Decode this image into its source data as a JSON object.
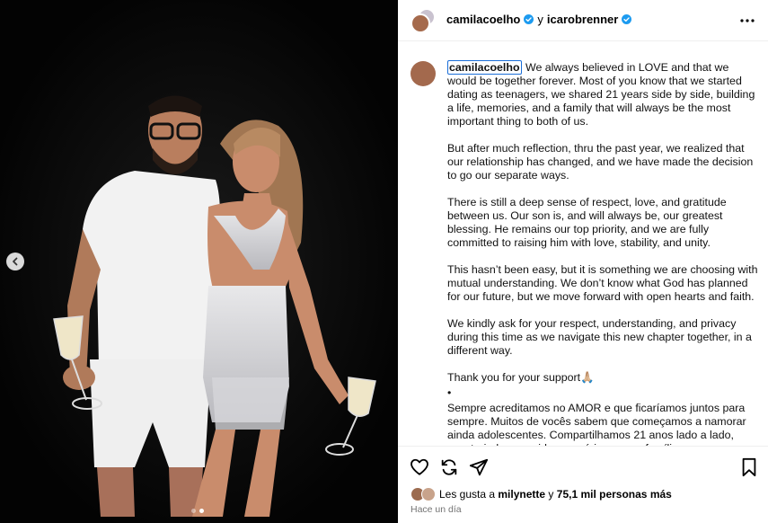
{
  "post": {
    "author": "camilacoelho",
    "joiner": "y",
    "coauthor": "icarobrenner",
    "caption_user": "camilacoelho",
    "caption": [
      "We always believed in LOVE and that we would be together forever. Most of you know that we started dating as teenagers, we shared 21 years side by side, building a life, memories, and a family that will always be the most important thing to both of us.",
      "But after much reflection, thru the past year, we realized that our relationship has changed, and we have made the decision to go our separate ways.",
      "There is still a deep sense of respect, love, and gratitude between us. Our son is, and will always be, our greatest blessing. He remains our top priority, and we are fully committed to raising him with love, stability, and unity.",
      "This hasn’t been easy, but it is something we are choosing with mutual understanding. We don’t know what God has planned for our future, but we move forward with open hearts and faith.",
      "We kindly ask for your respect, understanding, and privacy during this time as we navigate this new chapter together, in a different way.",
      "Thank you for your support🙏🏼",
      "•",
      "Sempre acreditamos no AMOR e que ficaríamos juntos para sempre. Muitos de vocês sabem que começamos a namorar ainda adolescentes. Compartilhamos 21 anos lado a lado, construindo uma vida, memórias e uma família que sempre será"
    ],
    "likes": {
      "prefix": "Les gusta a",
      "user": "milynette",
      "joiner": "y",
      "others": "75,1 mil personas más"
    },
    "timestamp": "Hace un día"
  },
  "carousel": {
    "slide": 2,
    "total": 2
  },
  "icons": {
    "header": [
      "more-options-icon"
    ],
    "actions": [
      "heart-icon",
      "repost-icon",
      "share-icon",
      "bookmark-icon"
    ],
    "media": [
      "chevron-left-icon"
    ],
    "badge": "verified-badge-icon"
  },
  "colors": {
    "verified": "#1d9bf0",
    "caption_highlight": "#1a6ed8",
    "photo_bg": "#050505"
  }
}
